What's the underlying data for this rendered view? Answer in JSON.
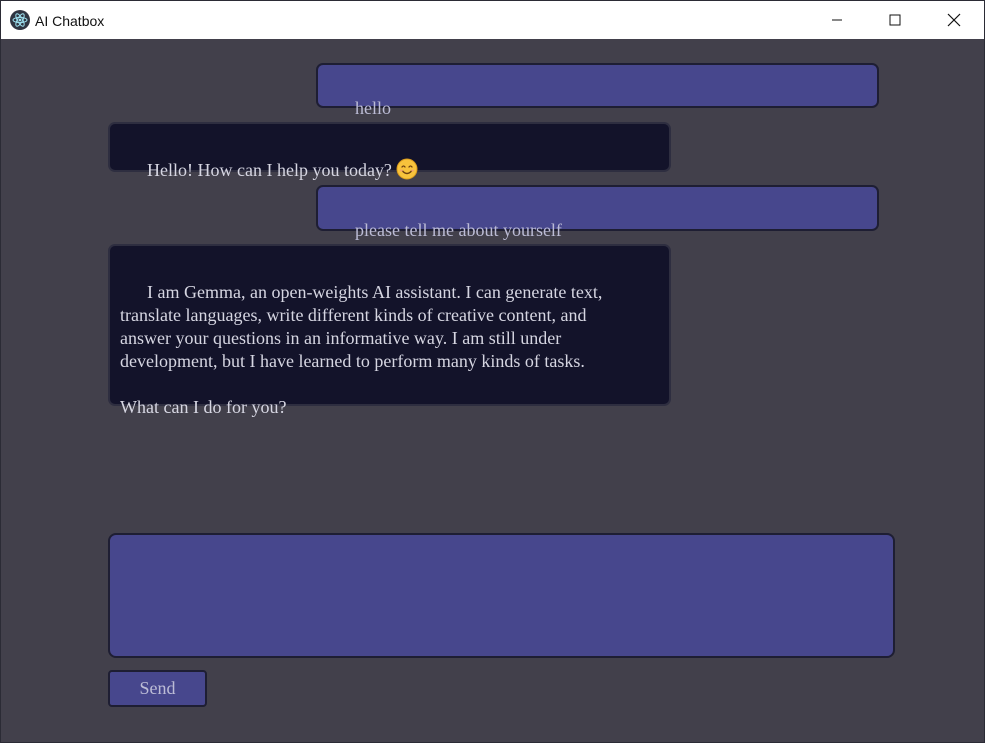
{
  "window": {
    "title": "AI Chatbox",
    "app_icon": "electron-icon",
    "controls": {
      "minimize_icon": "minimize-icon",
      "maximize_icon": "maximize-icon",
      "close_icon": "close-icon"
    }
  },
  "messages": [
    {
      "role": "user",
      "text": "hello"
    },
    {
      "role": "assistant",
      "text": "Hello! How can I help you today?",
      "emoji": "smiling-face-emoji"
    },
    {
      "role": "user",
      "text": "please tell me about yourself"
    },
    {
      "role": "assistant",
      "text": "I am Gemma, an open-weights AI assistant. I can generate text,\ntranslate languages, write different kinds of creative content, and\nanswer your questions in an informative way. I am still under\ndevelopment, but I have learned to perform many kinds of tasks.\n\nWhat can I do for you?"
    }
  ],
  "composer": {
    "input_value": "",
    "send_label": "Send"
  },
  "colors": {
    "background": "#42404b",
    "user_bubble": "#47478d",
    "assistant_bubble": "#13132a",
    "text_light": "#d6d6e2",
    "text_muted": "#bcbcd6"
  }
}
